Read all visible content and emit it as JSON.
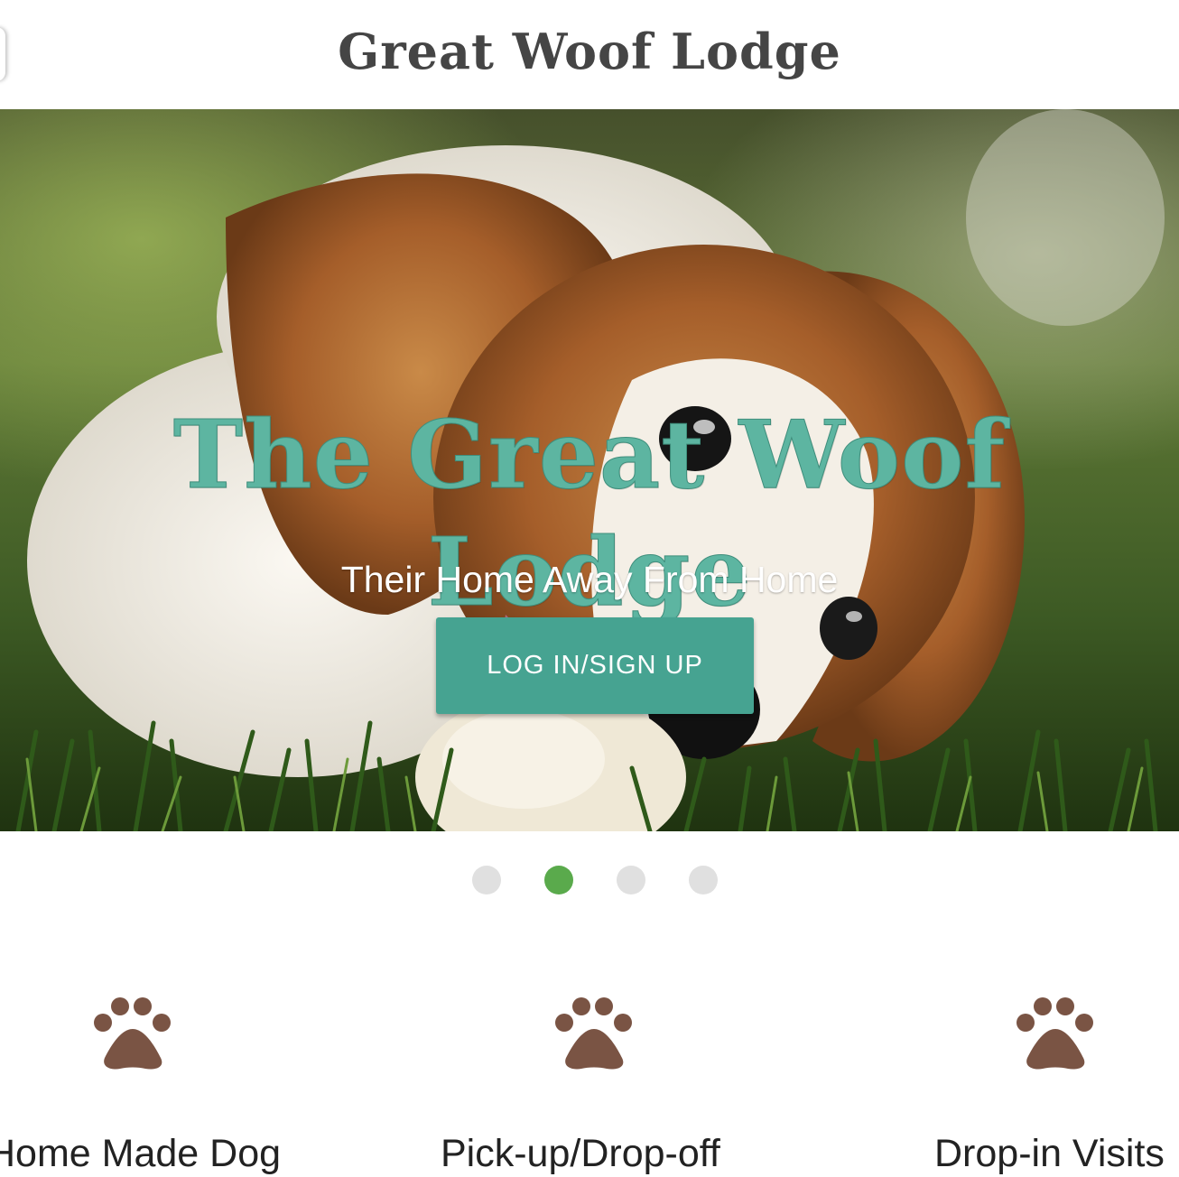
{
  "header": {
    "site_title": "Great Woof Lodge"
  },
  "hero": {
    "image": "puppy-in-grass-photo",
    "title": "The Great Woof Lodge",
    "subtitle": "Their Home Away From Home",
    "cta_label": "LOG IN/SIGN UP"
  },
  "carousel": {
    "slide_count": 4,
    "active_index": 1
  },
  "features": [
    {
      "icon": "paw-icon",
      "label": "Home Made Dog"
    },
    {
      "icon": "paw-icon",
      "label": "Pick-up/Drop-off"
    },
    {
      "icon": "paw-icon",
      "label": "Drop-in Visits"
    }
  ],
  "colors": {
    "accent": "#46a391",
    "hero_title": "#5db5a1",
    "paw": "#7a5444",
    "dot_active": "#5aaa4c",
    "dot_inactive": "#e0e0e0"
  }
}
